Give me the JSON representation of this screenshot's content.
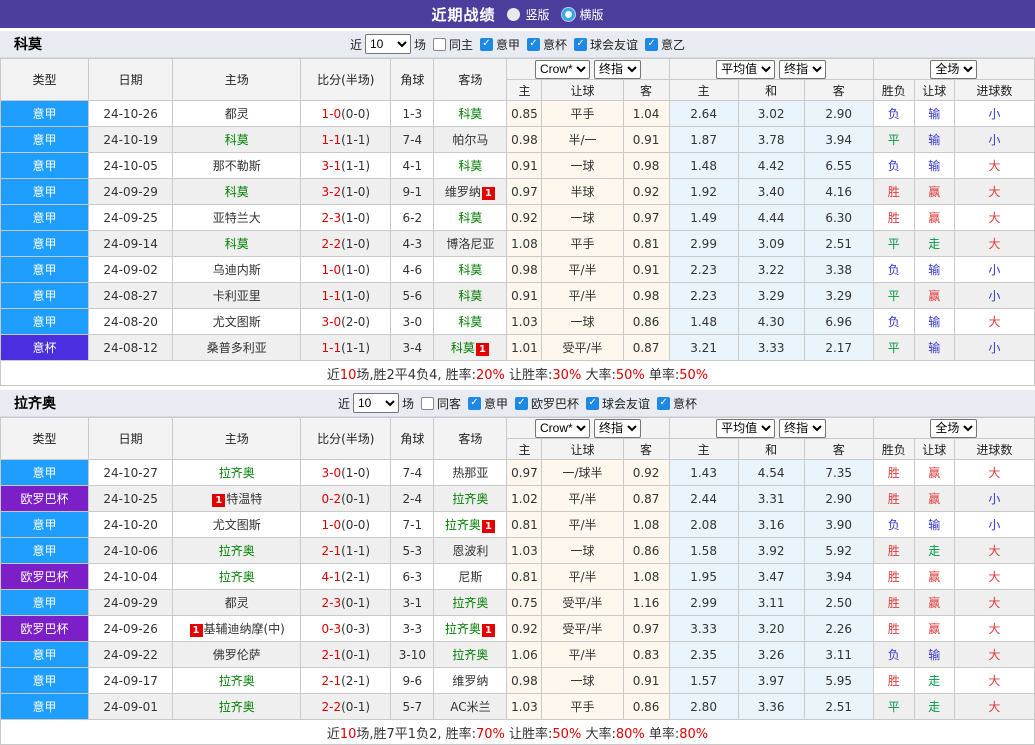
{
  "header": {
    "title": "近期战绩",
    "radios": [
      {
        "label": "竖版",
        "checked": false
      },
      {
        "label": "横版",
        "checked": true
      }
    ]
  },
  "league_colors": {
    "意甲": "#1E9FFF",
    "意杯": "#4B2EE0",
    "欧罗巴杯": "#7D1FC8"
  },
  "table_headers": {
    "static": [
      "类型",
      "日期",
      "主场",
      "比分(半场)",
      "角球",
      "客场"
    ],
    "groups": [
      {
        "selects": [
          "Crow*",
          "终指"
        ],
        "cols": [
          "主",
          "让球",
          "客"
        ]
      },
      {
        "selects": [
          "平均值",
          "终指"
        ],
        "cols": [
          "主",
          "和",
          "客"
        ]
      },
      {
        "selects": [
          "全场"
        ],
        "cols": [
          "胜负",
          "让球",
          "进球数"
        ]
      }
    ]
  },
  "sections": [
    {
      "team": "科莫",
      "filter": {
        "near_label": "近",
        "count": "10",
        "games_label": "场",
        "same": {
          "label": "同主",
          "checked": false
        },
        "leagues": [
          {
            "label": "意甲",
            "checked": true
          },
          {
            "label": "意杯",
            "checked": true
          },
          {
            "label": "球会友谊",
            "checked": true
          },
          {
            "label": "意乙",
            "checked": true
          }
        ]
      },
      "rows": [
        {
          "lg": "意甲",
          "date": "24-10-26",
          "h": "都灵",
          "hg": false,
          "hb": null,
          "ft": "1-0",
          "ht": "(0-0)",
          "cn": "1-3",
          "a": "科莫",
          "ag": true,
          "ab": null,
          "o": [
            "0.85",
            "平手",
            "1.04"
          ],
          "v": [
            "2.64",
            "3.02",
            "2.90"
          ],
          "r": [
            [
              "负",
              "b"
            ],
            [
              "输",
              "b"
            ],
            [
              "小",
              "b"
            ]
          ]
        },
        {
          "lg": "意甲",
          "date": "24-10-19",
          "h": "科莫",
          "hg": true,
          "hb": null,
          "ft": "1-1",
          "ht": "(1-1)",
          "cn": "7-4",
          "a": "帕尔马",
          "ag": false,
          "ab": null,
          "o": [
            "0.98",
            "半/一",
            "0.91"
          ],
          "v": [
            "1.87",
            "3.78",
            "3.94"
          ],
          "r": [
            [
              "平",
              "g"
            ],
            [
              "输",
              "b"
            ],
            [
              "小",
              "b"
            ]
          ]
        },
        {
          "lg": "意甲",
          "date": "24-10-05",
          "h": "那不勒斯",
          "hg": false,
          "hb": null,
          "ft": "3-1",
          "ht": "(1-1)",
          "cn": "4-1",
          "a": "科莫",
          "ag": true,
          "ab": null,
          "o": [
            "0.91",
            "一球",
            "0.98"
          ],
          "v": [
            "1.48",
            "4.42",
            "6.55"
          ],
          "r": [
            [
              "负",
              "b"
            ],
            [
              "输",
              "b"
            ],
            [
              "大",
              "r"
            ]
          ]
        },
        {
          "lg": "意甲",
          "date": "24-09-29",
          "h": "科莫",
          "hg": true,
          "hb": null,
          "ft": "3-2",
          "ht": "(1-0)",
          "cn": "9-1",
          "a": "维罗纳",
          "ag": false,
          "ab": "1",
          "o": [
            "0.97",
            "半球",
            "0.92"
          ],
          "v": [
            "1.92",
            "3.40",
            "4.16"
          ],
          "r": [
            [
              "胜",
              "r"
            ],
            [
              "赢",
              "r"
            ],
            [
              "大",
              "r"
            ]
          ]
        },
        {
          "lg": "意甲",
          "date": "24-09-25",
          "h": "亚特兰大",
          "hg": false,
          "hb": null,
          "ft": "2-3",
          "ht": "(1-0)",
          "cn": "6-2",
          "a": "科莫",
          "ag": true,
          "ab": null,
          "o": [
            "0.92",
            "一球",
            "0.97"
          ],
          "v": [
            "1.49",
            "4.44",
            "6.30"
          ],
          "r": [
            [
              "胜",
              "r"
            ],
            [
              "赢",
              "r"
            ],
            [
              "大",
              "r"
            ]
          ]
        },
        {
          "lg": "意甲",
          "date": "24-09-14",
          "h": "科莫",
          "hg": true,
          "hb": null,
          "ft": "2-2",
          "ht": "(1-0)",
          "cn": "4-3",
          "a": "博洛尼亚",
          "ag": false,
          "ab": null,
          "o": [
            "1.08",
            "平手",
            "0.81"
          ],
          "v": [
            "2.99",
            "3.09",
            "2.51"
          ],
          "r": [
            [
              "平",
              "g"
            ],
            [
              "走",
              "g"
            ],
            [
              "大",
              "r"
            ]
          ]
        },
        {
          "lg": "意甲",
          "date": "24-09-02",
          "h": "乌迪内斯",
          "hg": false,
          "hb": null,
          "ft": "1-0",
          "ht": "(1-0)",
          "cn": "4-6",
          "a": "科莫",
          "ag": true,
          "ab": null,
          "o": [
            "0.98",
            "平/半",
            "0.91"
          ],
          "v": [
            "2.23",
            "3.22",
            "3.38"
          ],
          "r": [
            [
              "负",
              "b"
            ],
            [
              "输",
              "b"
            ],
            [
              "小",
              "b"
            ]
          ]
        },
        {
          "lg": "意甲",
          "date": "24-08-27",
          "h": "卡利亚里",
          "hg": false,
          "hb": null,
          "ft": "1-1",
          "ht": "(1-0)",
          "cn": "5-6",
          "a": "科莫",
          "ag": true,
          "ab": null,
          "o": [
            "0.91",
            "平/半",
            "0.98"
          ],
          "v": [
            "2.23",
            "3.29",
            "3.29"
          ],
          "r": [
            [
              "平",
              "g"
            ],
            [
              "赢",
              "r"
            ],
            [
              "小",
              "b"
            ]
          ]
        },
        {
          "lg": "意甲",
          "date": "24-08-20",
          "h": "尤文图斯",
          "hg": false,
          "hb": null,
          "ft": "3-0",
          "ht": "(2-0)",
          "cn": "3-0",
          "a": "科莫",
          "ag": true,
          "ab": null,
          "o": [
            "1.03",
            "一球",
            "0.86"
          ],
          "v": [
            "1.48",
            "4.30",
            "6.96"
          ],
          "r": [
            [
              "负",
              "b"
            ],
            [
              "输",
              "b"
            ],
            [
              "大",
              "r"
            ]
          ]
        },
        {
          "lg": "意杯",
          "date": "24-08-12",
          "h": "桑普多利亚",
          "hg": false,
          "hb": null,
          "ft": "1-1",
          "ht": "(1-1)",
          "cn": "3-4",
          "a": "科莫",
          "ag": true,
          "ab": "1",
          "o": [
            "1.01",
            "受平/半",
            "0.87"
          ],
          "v": [
            "3.21",
            "3.33",
            "2.17"
          ],
          "r": [
            [
              "平",
              "g"
            ],
            [
              "输",
              "b"
            ],
            [
              "小",
              "b"
            ]
          ]
        }
      ],
      "summary": [
        {
          "t": "近",
          "red": false
        },
        {
          "t": "10",
          "red": true
        },
        {
          "t": "场,胜2平4负4, 胜率:",
          "red": false
        },
        {
          "t": "20%",
          "red": true
        },
        {
          "t": " 让胜率:",
          "red": false
        },
        {
          "t": "30%",
          "red": true
        },
        {
          "t": " 大率:",
          "red": false
        },
        {
          "t": "50%",
          "red": true
        },
        {
          "t": " 单率:",
          "red": false
        },
        {
          "t": "50%",
          "red": true
        }
      ]
    },
    {
      "team": "拉齐奥",
      "filter": {
        "near_label": "近",
        "count": "10",
        "games_label": "场",
        "same": {
          "label": "同客",
          "checked": false
        },
        "leagues": [
          {
            "label": "意甲",
            "checked": true
          },
          {
            "label": "欧罗巴杯",
            "checked": true
          },
          {
            "label": "球会友谊",
            "checked": true
          },
          {
            "label": "意杯",
            "checked": true
          }
        ]
      },
      "rows": [
        {
          "lg": "意甲",
          "date": "24-10-27",
          "h": "拉齐奥",
          "hg": true,
          "hb": null,
          "ft": "3-0",
          "ht": "(1-0)",
          "cn": "7-4",
          "a": "热那亚",
          "ag": false,
          "ab": null,
          "o": [
            "0.97",
            "一/球半",
            "0.92"
          ],
          "v": [
            "1.43",
            "4.54",
            "7.35"
          ],
          "r": [
            [
              "胜",
              "r"
            ],
            [
              "赢",
              "r"
            ],
            [
              "大",
              "r"
            ]
          ]
        },
        {
          "lg": "欧罗巴杯",
          "date": "24-10-25",
          "h": "特温特",
          "hg": false,
          "hb": "1",
          "ft": "0-2",
          "ht": "(0-1)",
          "cn": "2-4",
          "a": "拉齐奥",
          "ag": true,
          "ab": null,
          "o": [
            "1.02",
            "平/半",
            "0.87"
          ],
          "v": [
            "2.44",
            "3.31",
            "2.90"
          ],
          "r": [
            [
              "胜",
              "r"
            ],
            [
              "赢",
              "r"
            ],
            [
              "小",
              "b"
            ]
          ]
        },
        {
          "lg": "意甲",
          "date": "24-10-20",
          "h": "尤文图斯",
          "hg": false,
          "hb": null,
          "ft": "1-0",
          "ht": "(0-0)",
          "cn": "7-1",
          "a": "拉齐奥",
          "ag": true,
          "ab": "1",
          "o": [
            "0.81",
            "平/半",
            "1.08"
          ],
          "v": [
            "2.08",
            "3.16",
            "3.90"
          ],
          "r": [
            [
              "负",
              "b"
            ],
            [
              "输",
              "b"
            ],
            [
              "小",
              "b"
            ]
          ]
        },
        {
          "lg": "意甲",
          "date": "24-10-06",
          "h": "拉齐奥",
          "hg": true,
          "hb": null,
          "ft": "2-1",
          "ht": "(1-1)",
          "cn": "5-3",
          "a": "恩波利",
          "ag": false,
          "ab": null,
          "o": [
            "1.03",
            "一球",
            "0.86"
          ],
          "v": [
            "1.58",
            "3.92",
            "5.92"
          ],
          "r": [
            [
              "胜",
              "r"
            ],
            [
              "走",
              "g"
            ],
            [
              "大",
              "r"
            ]
          ]
        },
        {
          "lg": "欧罗巴杯",
          "date": "24-10-04",
          "h": "拉齐奥",
          "hg": true,
          "hb": null,
          "ft": "4-1",
          "ht": "(2-1)",
          "cn": "6-3",
          "a": "尼斯",
          "ag": false,
          "ab": null,
          "o": [
            "0.81",
            "平/半",
            "1.08"
          ],
          "v": [
            "1.95",
            "3.47",
            "3.94"
          ],
          "r": [
            [
              "胜",
              "r"
            ],
            [
              "赢",
              "r"
            ],
            [
              "大",
              "r"
            ]
          ]
        },
        {
          "lg": "意甲",
          "date": "24-09-29",
          "h": "都灵",
          "hg": false,
          "hb": null,
          "ft": "2-3",
          "ht": "(0-1)",
          "cn": "3-1",
          "a": "拉齐奥",
          "ag": true,
          "ab": null,
          "o": [
            "0.75",
            "受平/半",
            "1.16"
          ],
          "v": [
            "2.99",
            "3.11",
            "2.50"
          ],
          "r": [
            [
              "胜",
              "r"
            ],
            [
              "赢",
              "r"
            ],
            [
              "大",
              "r"
            ]
          ]
        },
        {
          "lg": "欧罗巴杯",
          "date": "24-09-26",
          "h": "基辅迪纳摩(中)",
          "hg": false,
          "hb": "1",
          "ft": "0-3",
          "ht": "(0-3)",
          "cn": "3-3",
          "a": "拉齐奥",
          "ag": true,
          "ab": "1",
          "o": [
            "0.92",
            "受平/半",
            "0.97"
          ],
          "v": [
            "3.33",
            "3.20",
            "2.26"
          ],
          "r": [
            [
              "胜",
              "r"
            ],
            [
              "赢",
              "r"
            ],
            [
              "大",
              "r"
            ]
          ]
        },
        {
          "lg": "意甲",
          "date": "24-09-22",
          "h": "佛罗伦萨",
          "hg": false,
          "hb": null,
          "ft": "2-1",
          "ht": "(0-1)",
          "cn": "3-10",
          "a": "拉齐奥",
          "ag": true,
          "ab": null,
          "o": [
            "1.06",
            "平/半",
            "0.83"
          ],
          "v": [
            "2.35",
            "3.26",
            "3.11"
          ],
          "r": [
            [
              "负",
              "b"
            ],
            [
              "输",
              "b"
            ],
            [
              "大",
              "r"
            ]
          ]
        },
        {
          "lg": "意甲",
          "date": "24-09-17",
          "h": "拉齐奥",
          "hg": true,
          "hb": null,
          "ft": "2-1",
          "ht": "(2-1)",
          "cn": "9-6",
          "a": "维罗纳",
          "ag": false,
          "ab": null,
          "o": [
            "0.98",
            "一球",
            "0.91"
          ],
          "v": [
            "1.57",
            "3.97",
            "5.95"
          ],
          "r": [
            [
              "胜",
              "r"
            ],
            [
              "走",
              "g"
            ],
            [
              "大",
              "r"
            ]
          ]
        },
        {
          "lg": "意甲",
          "date": "24-09-01",
          "h": "拉齐奥",
          "hg": true,
          "hb": null,
          "ft": "2-2",
          "ht": "(0-1)",
          "cn": "5-7",
          "a": "AC米兰",
          "ag": false,
          "ab": null,
          "o": [
            "1.03",
            "平手",
            "0.86"
          ],
          "v": [
            "2.80",
            "3.36",
            "2.51"
          ],
          "r": [
            [
              "平",
              "g"
            ],
            [
              "走",
              "g"
            ],
            [
              "大",
              "r"
            ]
          ]
        }
      ],
      "summary": [
        {
          "t": "近",
          "red": false
        },
        {
          "t": "10",
          "red": true
        },
        {
          "t": "场,胜7平1负2, 胜率:",
          "red": false
        },
        {
          "t": "70%",
          "red": true
        },
        {
          "t": " 让胜率:",
          "red": false
        },
        {
          "t": "50%",
          "red": true
        },
        {
          "t": " 大率:",
          "red": false
        },
        {
          "t": "80%",
          "red": true
        },
        {
          "t": " 单率:",
          "red": false
        },
        {
          "t": "80%",
          "red": true
        }
      ]
    }
  ]
}
